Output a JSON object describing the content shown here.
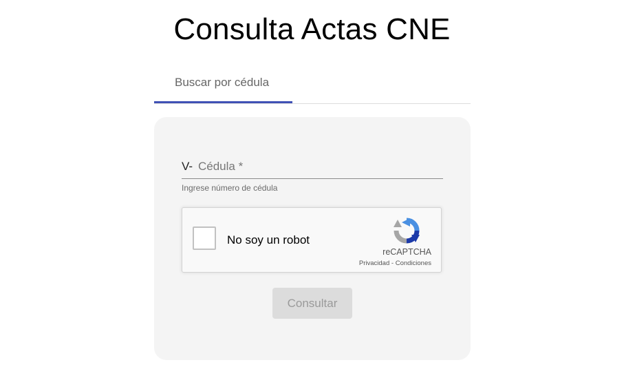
{
  "page": {
    "title": "Consulta Actas CNE"
  },
  "tabs": [
    {
      "label": "Buscar por cédula",
      "active": true
    }
  ],
  "form": {
    "cedula_prefix": "V-",
    "cedula_placeholder": "Cédula *",
    "cedula_value": "",
    "cedula_hint": "Ingrese número de cédula",
    "submit_label": "Consultar",
    "submit_disabled": true
  },
  "recaptcha": {
    "label": "No soy un robot",
    "checked": false,
    "brand": "reCAPTCHA",
    "privacy_label": "Privacidad",
    "separator": " - ",
    "terms_label": "Condiciones",
    "icon": "recaptcha-logo-icon"
  },
  "colors": {
    "accent": "#3f51b5",
    "card_background": "#f4f4f4",
    "button_disabled_bg": "#dcdcdc",
    "button_disabled_text": "#9a9a9a",
    "recaptcha_blue": "#4a90e2",
    "recaptcha_dark_blue": "#1c3aa9",
    "recaptcha_gray": "#a6a6a6"
  }
}
